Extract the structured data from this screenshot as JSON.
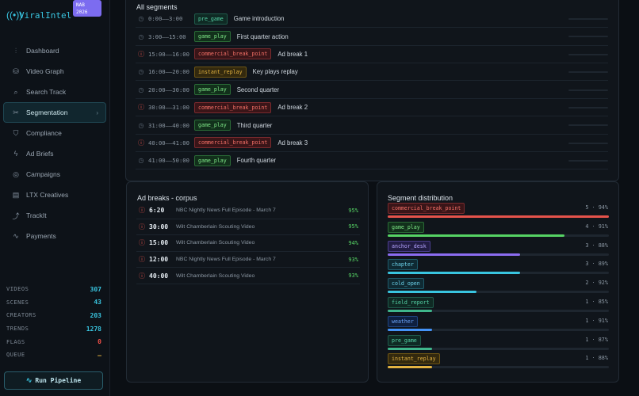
{
  "brand": {
    "name": "ViralIntel",
    "badge_line1": "NAB",
    "badge_line2": "2026"
  },
  "nav": [
    {
      "label": "Dashboard",
      "icon": "bar-chart-icon",
      "glyph": "⫶"
    },
    {
      "label": "Video Graph",
      "icon": "database-icon",
      "glyph": "⛁"
    },
    {
      "label": "Search Track",
      "icon": "search-icon",
      "glyph": "⌕"
    },
    {
      "label": "Segmentation",
      "icon": "scissors-icon",
      "glyph": "✂",
      "active": true
    },
    {
      "label": "Compliance",
      "icon": "shield-icon",
      "glyph": "⛉"
    },
    {
      "label": "Ad Briefs",
      "icon": "bolt-icon",
      "glyph": "ϟ"
    },
    {
      "label": "Campaigns",
      "icon": "target-icon",
      "glyph": "◎"
    },
    {
      "label": "LTX Creatives",
      "icon": "film-icon",
      "glyph": "▤"
    },
    {
      "label": "TrackIt",
      "icon": "route-icon",
      "glyph": "⤴"
    },
    {
      "label": "Payments",
      "icon": "activity-icon",
      "glyph": "∿"
    }
  ],
  "stats": [
    {
      "key": "VIDEOS",
      "value": "307",
      "color": "#39c5e0"
    },
    {
      "key": "SCENES",
      "value": "43",
      "color": "#39c5e0"
    },
    {
      "key": "CREATORS",
      "value": "203",
      "color": "#39c5e0"
    },
    {
      "key": "TRENDS",
      "value": "1278",
      "color": "#39c5e0"
    },
    {
      "key": "FLAGS",
      "value": "0",
      "color": "#f85149"
    },
    {
      "key": "QUEUE",
      "value": "—",
      "color": "#e3b341"
    }
  ],
  "run_button": "Run Pipeline",
  "segments_panel": {
    "title": "All segments",
    "rows": [
      {
        "time": "0:00––3:00",
        "tag": "pre_game",
        "label": "Game introduction",
        "kind": "pre_game"
      },
      {
        "time": "3:00––15:00",
        "tag": "game_play",
        "label": "First quarter action",
        "kind": "game_play"
      },
      {
        "time": "15:00––16:00",
        "tag": "commercial_break_point",
        "label": "Ad break 1",
        "kind": "commercial"
      },
      {
        "time": "16:00––20:00",
        "tag": "instant_replay",
        "label": "Key plays replay",
        "kind": "instant_replay"
      },
      {
        "time": "20:00––30:00",
        "tag": "game_play",
        "label": "Second quarter",
        "kind": "game_play"
      },
      {
        "time": "30:00––31:00",
        "tag": "commercial_break_point",
        "label": "Ad break 2",
        "kind": "commercial"
      },
      {
        "time": "31:00––40:00",
        "tag": "game_play",
        "label": "Third quarter",
        "kind": "game_play"
      },
      {
        "time": "40:00––41:00",
        "tag": "commercial_break_point",
        "label": "Ad break 3",
        "kind": "commercial"
      },
      {
        "time": "41:00––50:00",
        "tag": "game_play",
        "label": "Fourth quarter",
        "kind": "game_play"
      }
    ]
  },
  "ad_panel": {
    "title": "Ad breaks - corpus",
    "rows": [
      {
        "time": "6:20",
        "title": "NBC Nightly News Full Episode - March 7",
        "pct": "95%"
      },
      {
        "time": "30:00",
        "title": "Wilt Chamberlain Scouting Video",
        "pct": "95%"
      },
      {
        "time": "15:00",
        "title": "Wilt Chamberlain Scouting Video",
        "pct": "94%"
      },
      {
        "time": "12:00",
        "title": "NBC Nightly News Full Episode - March 7",
        "pct": "93%"
      },
      {
        "time": "40:00",
        "title": "Wilt Chamberlain Scouting Video",
        "pct": "93%"
      }
    ]
  },
  "dist_panel": {
    "title": "Segment distribution",
    "rows": [
      {
        "tag": "commercial_break_point",
        "value": "5 · 94%",
        "fraction": 1.0,
        "kind": "commercial",
        "bar": "#e5534b"
      },
      {
        "tag": "game_play",
        "value": "4 · 91%",
        "fraction": 0.8,
        "kind": "game_play",
        "bar": "#56d364"
      },
      {
        "tag": "anchor_desk",
        "value": "3 · 88%",
        "fraction": 0.6,
        "kind": "anchor_desk",
        "bar": "#8b6cf0"
      },
      {
        "tag": "chapter",
        "value": "3 · 89%",
        "fraction": 0.6,
        "kind": "chapter",
        "bar": "#39c5e0"
      },
      {
        "tag": "cold_open",
        "value": "2 · 92%",
        "fraction": 0.4,
        "kind": "chapter",
        "bar": "#39c5e0"
      },
      {
        "tag": "field_report",
        "value": "1 · 85%",
        "fraction": 0.2,
        "kind": "pre_game",
        "bar": "#3fb68b"
      },
      {
        "tag": "weather",
        "value": "1 · 91%",
        "fraction": 0.2,
        "kind": "weather",
        "bar": "#4493f8"
      },
      {
        "tag": "pre_game",
        "value": "1 · 87%",
        "fraction": 0.2,
        "kind": "pre_game",
        "bar": "#3fb68b"
      },
      {
        "tag": "instant_replay",
        "value": "1 · 88%",
        "fraction": 0.2,
        "kind": "instant_replay",
        "bar": "#e3b341"
      }
    ]
  },
  "tag_styles": {
    "pre_game": {
      "fg": "#56d4a8",
      "bg": "#0f2a24",
      "border": "#1f5a4a"
    },
    "game_play": {
      "fg": "#7ee787",
      "bg": "#12301b",
      "border": "#2a6b36"
    },
    "commercial": {
      "fg": "#f47067",
      "bg": "#3a1518",
      "border": "#7a2a2e"
    },
    "instant_replay": {
      "fg": "#e3b341",
      "bg": "#33290e",
      "border": "#6e5514"
    },
    "anchor_desk": {
      "fg": "#b4a4ff",
      "bg": "#221c44",
      "border": "#4a3d8c"
    },
    "chapter": {
      "fg": "#6cd4ec",
      "bg": "#0f2a33",
      "border": "#1f5a6a"
    },
    "weather": {
      "fg": "#6ca8ff",
      "bg": "#0f2040",
      "border": "#1f4480"
    }
  }
}
